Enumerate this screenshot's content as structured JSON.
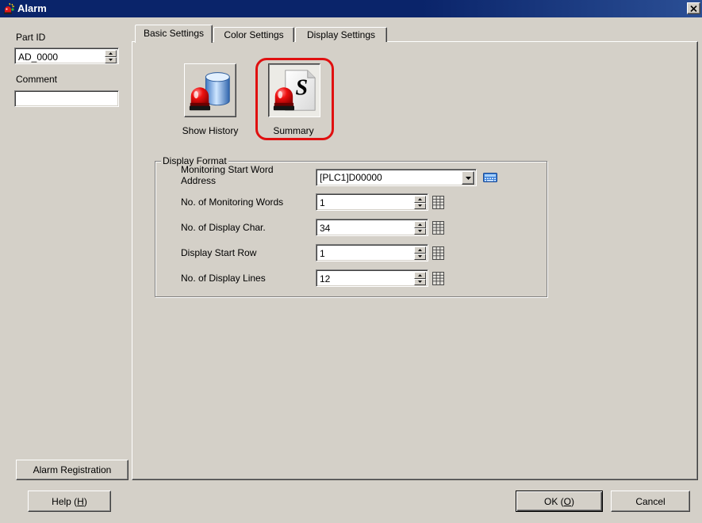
{
  "window": {
    "title": "Alarm",
    "app_icon": "alarm-app-icon",
    "close_icon": "close-icon"
  },
  "left_panel": {
    "part_id": {
      "label": "Part ID",
      "value": "AD_0000"
    },
    "comment": {
      "label": "Comment",
      "value": ""
    },
    "alarm_registration_button": "Alarm Registration"
  },
  "tabs": [
    {
      "label": "Basic Settings",
      "selected": true
    },
    {
      "label": "Color Settings",
      "selected": false
    },
    {
      "label": "Display Settings",
      "selected": false
    }
  ],
  "mode_buttons": [
    {
      "label": "Show History",
      "icon": "show-history-icon",
      "selected": false
    },
    {
      "label": "Summary",
      "icon": "summary-icon",
      "icon_glyph": "S",
      "selected": true,
      "highlighted": true
    }
  ],
  "display_format": {
    "title": "Display Format",
    "monitoring_start_word_address": {
      "label": "Monitoring Start Word Address",
      "value": "[PLC1]D00000",
      "dropdown_icon": "chevron-down-icon",
      "input_icon": "keypad-icon"
    },
    "rows": [
      {
        "label": "No. of Monitoring Words",
        "value": "1"
      },
      {
        "label": "No. of Display Char.",
        "value": "34"
      },
      {
        "label": "Display Start Row",
        "value": "1"
      },
      {
        "label": "No. of Display Lines",
        "value": "12"
      }
    ],
    "row_icon": "numpad-icon"
  },
  "footer": {
    "help": {
      "label": "Help (H)",
      "access_key": "H"
    },
    "ok": {
      "label": "OK (O)",
      "access_key": "O"
    },
    "cancel": {
      "label": "Cancel"
    }
  },
  "colors": {
    "title_bar": "#0a246a",
    "dialog_face": "#d4d0c8",
    "highlight": "#e01010"
  }
}
